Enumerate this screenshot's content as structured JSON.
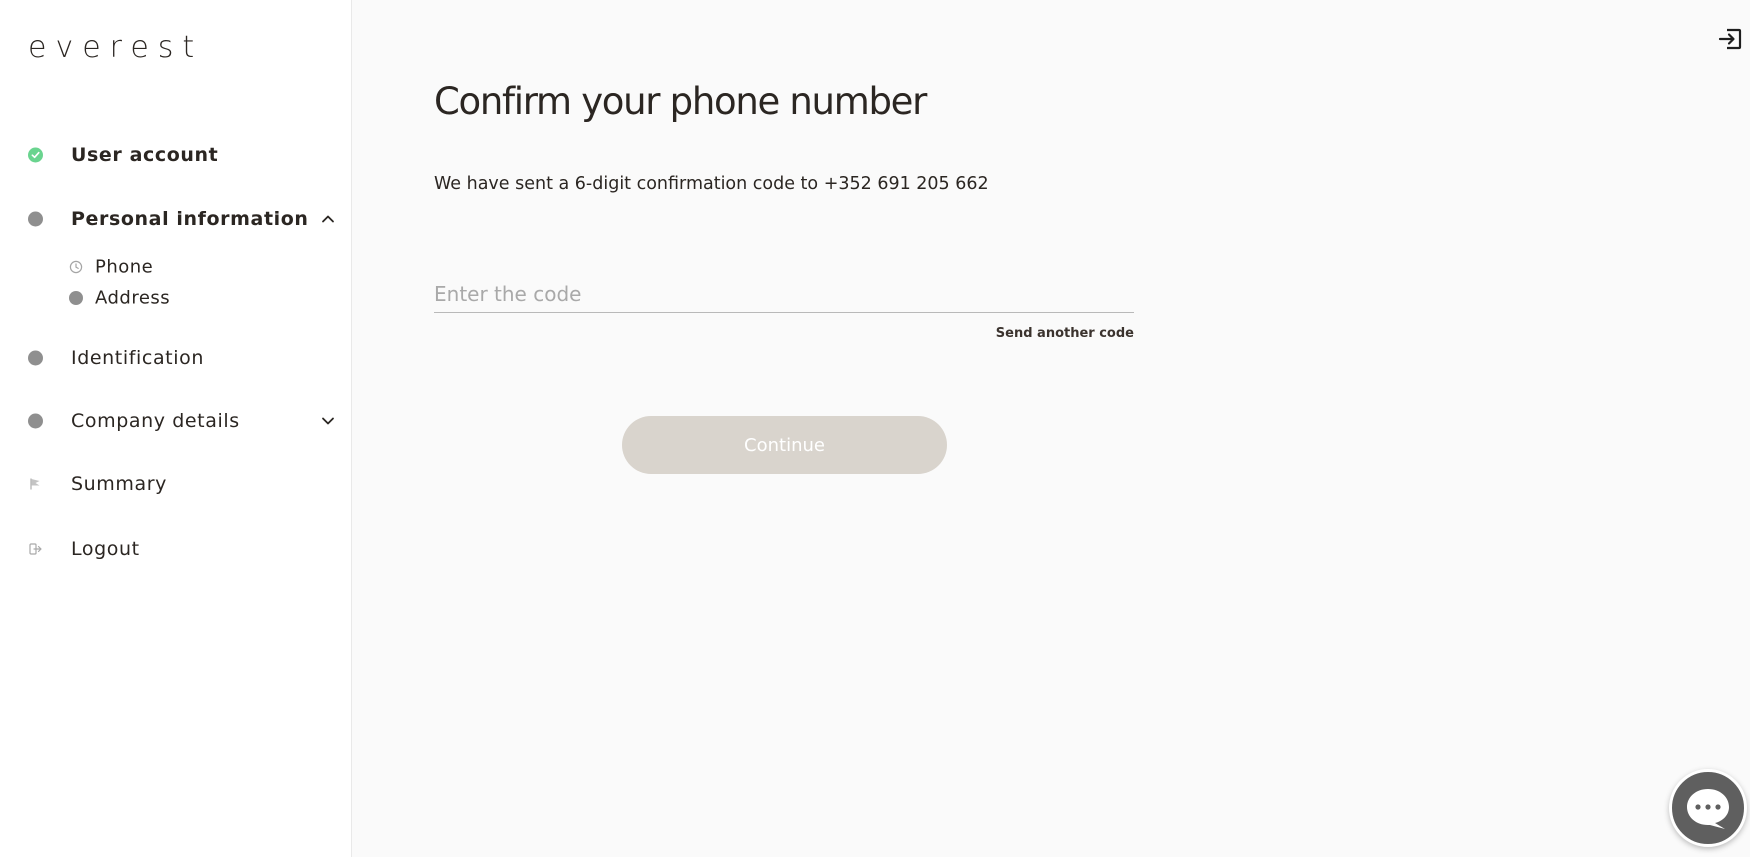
{
  "brand": {
    "logo_text": "everest"
  },
  "sidebar": {
    "items": [
      {
        "label": "User account",
        "status": "completed",
        "icon": "check-icon"
      },
      {
        "label": "Personal information",
        "status": "active",
        "expanded": true,
        "icon": "chevron-up-icon",
        "children": [
          {
            "label": "Phone",
            "icon": "clock-icon"
          },
          {
            "label": "Address",
            "icon": "dot-icon"
          }
        ]
      },
      {
        "label": "Identification",
        "status": "pending"
      },
      {
        "label": "Company details",
        "status": "pending",
        "expanded": false,
        "icon": "chevron-down-icon"
      },
      {
        "label": "Summary",
        "icon": "flag-icon"
      },
      {
        "label": "Logout",
        "icon": "logout-icon"
      }
    ]
  },
  "main": {
    "title": "Confirm your phone number",
    "subtitle": "We have sent a 6-digit confirmation code to +352 691 205 662",
    "code_input": {
      "placeholder": "Enter the code",
      "value": ""
    },
    "resend_label": "Send another code",
    "continue_label": "Continue"
  },
  "colors": {
    "completed_dot": "#6ad48f",
    "pending_dot": "#8f8f8f",
    "button_disabled_bg": "#d9d4cd",
    "text": "#2b2622"
  }
}
